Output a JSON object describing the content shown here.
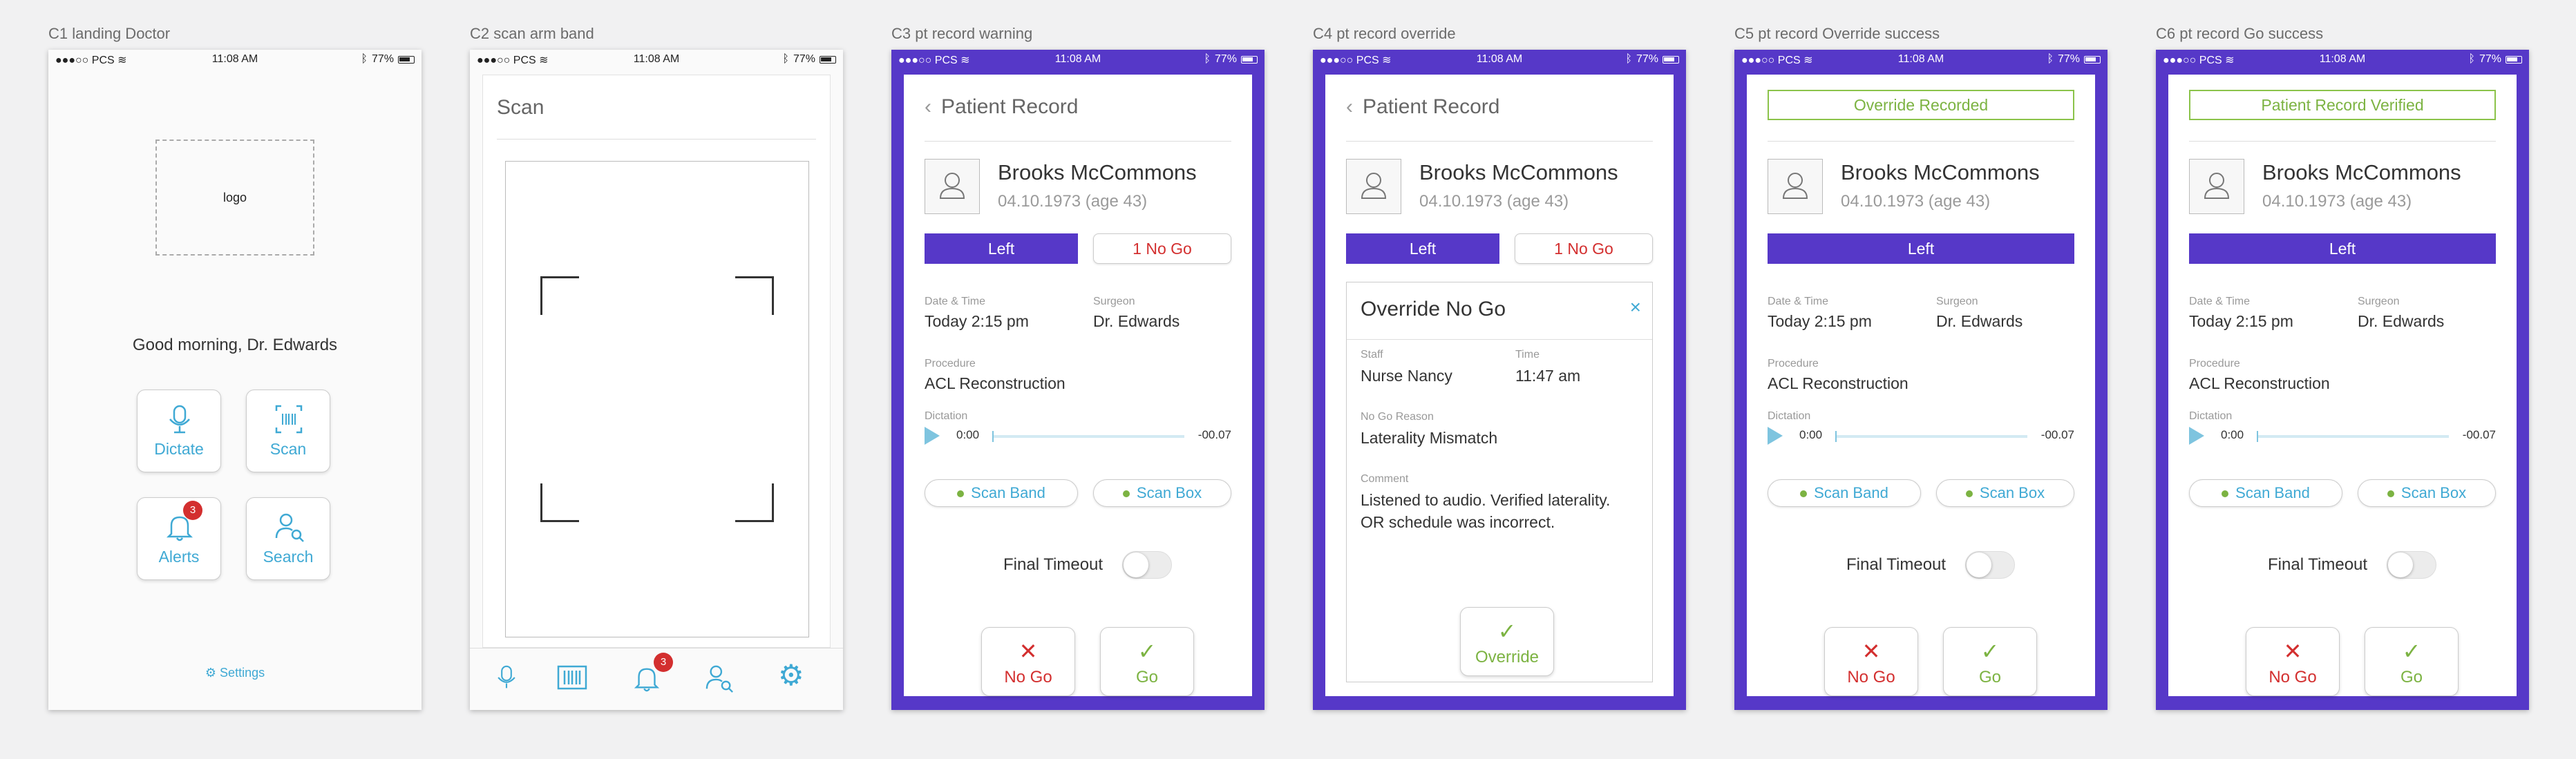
{
  "status": {
    "carrier": "●●●○○ PCS",
    "time": "11:08 AM",
    "battery": "77%"
  },
  "boards": [
    {
      "label": "C1 landing Doctor"
    },
    {
      "label": "C2 scan arm band"
    },
    {
      "label": "C3 pt record warning"
    },
    {
      "label": "C4 pt record override"
    },
    {
      "label": "C5 pt record Override success"
    },
    {
      "label": "C6 pt record Go success"
    }
  ],
  "c1": {
    "logo": "logo",
    "greeting": "Good morning, Dr. Edwards",
    "tiles": {
      "dictate": "Dictate",
      "scan": "Scan",
      "alerts": "Alerts",
      "search": "Search"
    },
    "alerts_count": "3",
    "settings": "Settings"
  },
  "c2": {
    "title": "Scan",
    "tab_alerts_count": "3"
  },
  "record": {
    "header": "Patient Record",
    "back": "‹",
    "name": "Brooks McCommons",
    "dob": "04.10.1973 (age 43)",
    "side": "Left",
    "nogo_count": "1 No Go",
    "datetime_label": "Date & Time",
    "datetime": "Today 2:15 pm",
    "surgeon_label": "Surgeon",
    "surgeon": "Dr. Edwards",
    "procedure_label": "Procedure",
    "procedure": "ACL Reconstruction",
    "dictation_label": "Dictation",
    "dict_start": "0:00",
    "dict_end": "-00.07",
    "scan_band": "Scan Band",
    "scan_box": "Scan Box",
    "final_timeout": "Final Timeout",
    "no_go": "No Go",
    "go": "Go"
  },
  "override": {
    "title": "Override No Go",
    "close": "×",
    "staff_label": "Staff",
    "staff": "Nurse Nancy",
    "time_label": "Time",
    "time": "11:47 am",
    "reason_label": "No Go Reason",
    "reason": "Laterality Mismatch",
    "comment_label": "Comment",
    "comment_1": "Listened to audio. Verified laterality.",
    "comment_2": "OR schedule was incorrect.",
    "button": "Override"
  },
  "c5": {
    "banner": "Override Recorded"
  },
  "c6": {
    "banner": "Patient Record Verified"
  },
  "colors": {
    "purple": "#5638c8",
    "blue": "#3fa9d4",
    "green": "#7cb342",
    "red": "#d32f2f"
  }
}
